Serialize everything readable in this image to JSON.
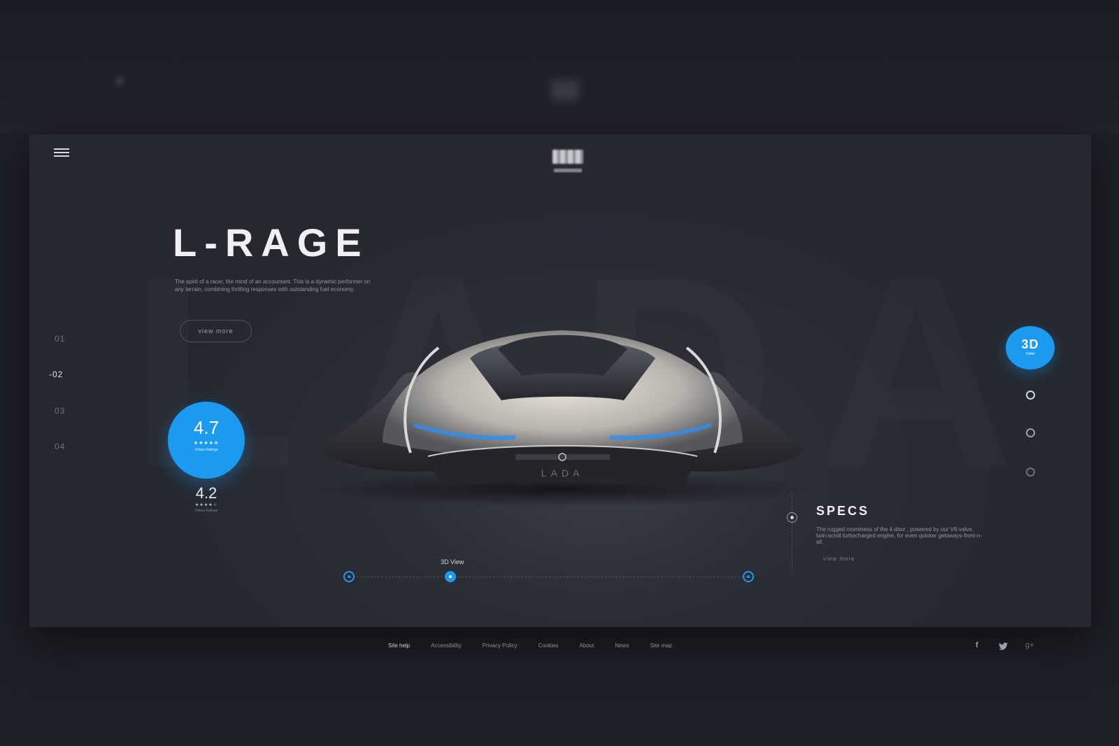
{
  "header": {
    "menu_icon": "hamburger-icon",
    "logo_icon": "brand-logo"
  },
  "hero": {
    "title": "L-RAGE",
    "description": "The spirit of a racer, the mind of an accountant. This is a dynamic performer on any terrain, combining thrilling responses with outstanding fuel economy.",
    "button_label": "view more",
    "watermark": "LADA"
  },
  "slides": [
    "01",
    "-02",
    "03",
    "04"
  ],
  "ratings": {
    "primary": {
      "value": "4.7",
      "stars": "★★★★★",
      "label": "Online Ratings"
    },
    "secondary": {
      "value": "4.2",
      "stars": "★★★★☆",
      "label": "Online Ratings"
    }
  },
  "view3d": {
    "big": "3D",
    "small": "View"
  },
  "specs": {
    "title": "SPECS",
    "description": "The rugged roominess of the 4-door , powered by our V6-valve, twin-scroll turbocharged engine, for even quicker getaways-front-n-all.",
    "link": "view more"
  },
  "timeline": {
    "label": "3D View"
  },
  "footer": {
    "links": [
      "Site help",
      "Accessibility",
      "Privacy Policy",
      "Cookies",
      "About",
      "News",
      "Site map"
    ],
    "social_icons": [
      "facebook-icon",
      "twitter-icon",
      "google-plus-icon"
    ]
  },
  "colors": {
    "accent": "#1b9af0",
    "background": "#1d2027",
    "card": "#2b2e36"
  }
}
